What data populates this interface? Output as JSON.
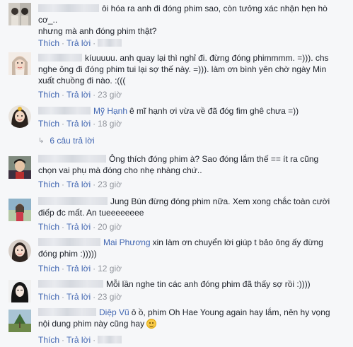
{
  "labels": {
    "like": "Thích",
    "reply": "Trả lời",
    "separator": "·"
  },
  "comments": [
    {
      "name": "",
      "text": "ôi hóa ra anh đi đóng phim sao, còn tưởng xác nhận hẹn hò cơ_..",
      "text2": "nhưng mà anh đóng phim thật?",
      "time": ""
    },
    {
      "name": "",
      "text": "kíuuuuu. anh quay lại thì nghỉ đi. đừng đóng phimmmm. =))). chs nghe ông đi đóng phim tui lại sợ thế này. =))). làm ơn bình yên chờ ngày Min xuất chuồng đi nào. :(((",
      "time": "23 giờ"
    },
    {
      "name": "Mỹ Hạnh",
      "text": "ê mĩ hạnh ơi vừa về đã đóg fim ghê chưa =))",
      "time": "18 giờ",
      "replies": "6 câu trả lời"
    },
    {
      "name": "",
      "text": "Ông thích đóng phim à? Sao đóng lắm thế == ít ra cũng chọn vai phụ mà đóng cho nhẹ nhàng chứ..",
      "time": "23 giờ"
    },
    {
      "name": "",
      "text": "Jung Bún đừng đóng phim nữa. Xem xong chắc toàn cười điếp đc mất. An tueeeeeeee",
      "time": "20 giờ"
    },
    {
      "name": "Mai Phương",
      "text": "xin làm ơn chuyển lời giúp t bảo ông ấy đừng đóng phim :)))))",
      "time": "12 giờ"
    },
    {
      "name": "",
      "text": "Mỗi lần nghe tin các anh đóng phim đã thấy sợ rồi :))))",
      "time": "23 giờ"
    },
    {
      "name": "Diệp Vũ",
      "text": "ô ồ, phim Oh Hae Young again hay lắm, nên hy vọng nội dung phim này cũng hay",
      "time": ""
    }
  ]
}
